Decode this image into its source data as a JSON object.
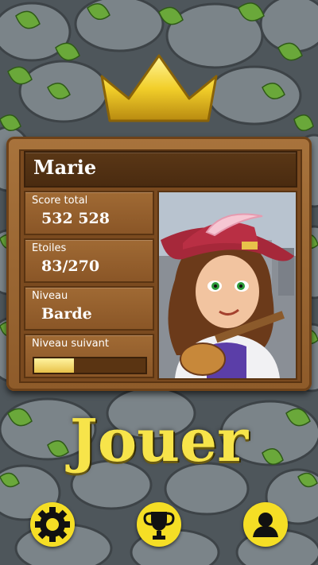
{
  "player": {
    "name": "Marie",
    "score_label": "Score total",
    "score_value": "532 528",
    "stars_label": "Etoiles",
    "stars_value": "83/270",
    "level_label": "Niveau",
    "level_value": "Barde",
    "next_level_label": "Niveau suivant",
    "next_level_progress": 0.36
  },
  "play_label": "Jouer",
  "colors": {
    "accent_yellow": "#f5de25",
    "wood": "#8e5b2a",
    "play_text": "#f7e44a"
  },
  "bottom_nav": [
    "gear-icon",
    "trophy-icon",
    "profile-icon"
  ]
}
